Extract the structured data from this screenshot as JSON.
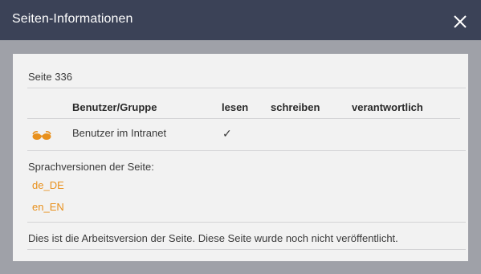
{
  "dialog": {
    "title": "Seiten-Informationen",
    "close_icon": "close-icon"
  },
  "page": {
    "label": "Seite 336"
  },
  "permissions": {
    "headers": {
      "user_group": "Benutzer/Gruppe",
      "read": "lesen",
      "write": "schreiben",
      "responsible": "verantwortlich"
    },
    "rows": [
      {
        "icon": "glasses-icon",
        "user_group": "Benutzer im Intranet",
        "read": "✓",
        "write": "",
        "responsible": ""
      }
    ]
  },
  "languages": {
    "label": "Sprachversionen der Seite:",
    "items": [
      "de_DE",
      "en_EN"
    ]
  },
  "footer": {
    "status_text": "Dies ist die Arbeitsversion der Seite. Diese Seite wurde noch nicht veröffentlicht."
  },
  "colors": {
    "titlebar": "#3b4257",
    "accent": "#e8901c",
    "panel": "#f2f2f2",
    "backdrop": "#9fa1a8"
  }
}
